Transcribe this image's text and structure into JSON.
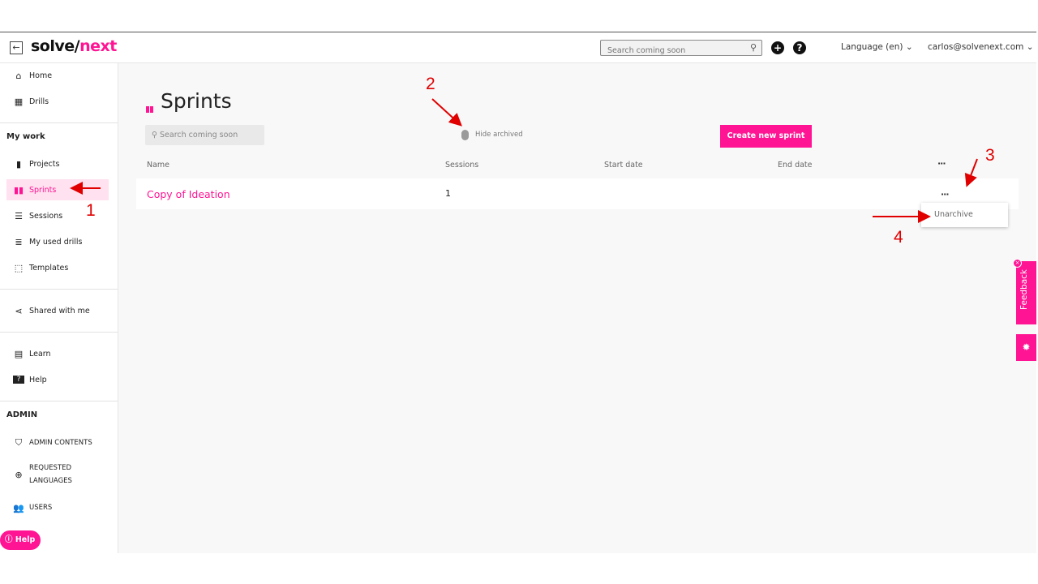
{
  "header": {
    "back_icon": "arrow-left-icon",
    "logo_part1": "solve/",
    "logo_part2": "next",
    "search_placeholder": "Search coming soon",
    "language": "Language (en)",
    "user_email": "carlos@solvenext.com"
  },
  "sidebar": {
    "home": "Home",
    "drills": "Drills",
    "my_work": "My work",
    "projects": "Projects",
    "sprints": "Sprints",
    "sessions": "Sessions",
    "my_used_drills": "My used drills",
    "templates": "Templates",
    "shared_with_me": "Shared with me",
    "learn": "Learn",
    "help": "Help",
    "admin": "ADMIN",
    "admin_contents": "ADMIN CONTENTS",
    "requested_languages_1": "REQUESTED",
    "requested_languages_2": "LANGUAGES",
    "users": "USERS",
    "help_pill": "Help"
  },
  "main": {
    "title": "Sprints",
    "search_placeholder": "Search coming soon",
    "hide_archived": "Hide archived",
    "create_button": "Create new sprint",
    "columns": [
      "Name",
      "Sessions",
      "Start date",
      "End date",
      "···"
    ],
    "rows": [
      {
        "name": "Copy of Ideation",
        "sessions": "1",
        "start_date": "",
        "end_date": ""
      }
    ],
    "row_menu": "···",
    "dropdown_item": "Unarchive"
  },
  "side_tabs": {
    "feedback": "Feedback",
    "close": "×"
  },
  "annotations": [
    "1",
    "2",
    "3",
    "4"
  ],
  "colors": {
    "accent": "#ff1493",
    "annotation": "#e00000"
  }
}
